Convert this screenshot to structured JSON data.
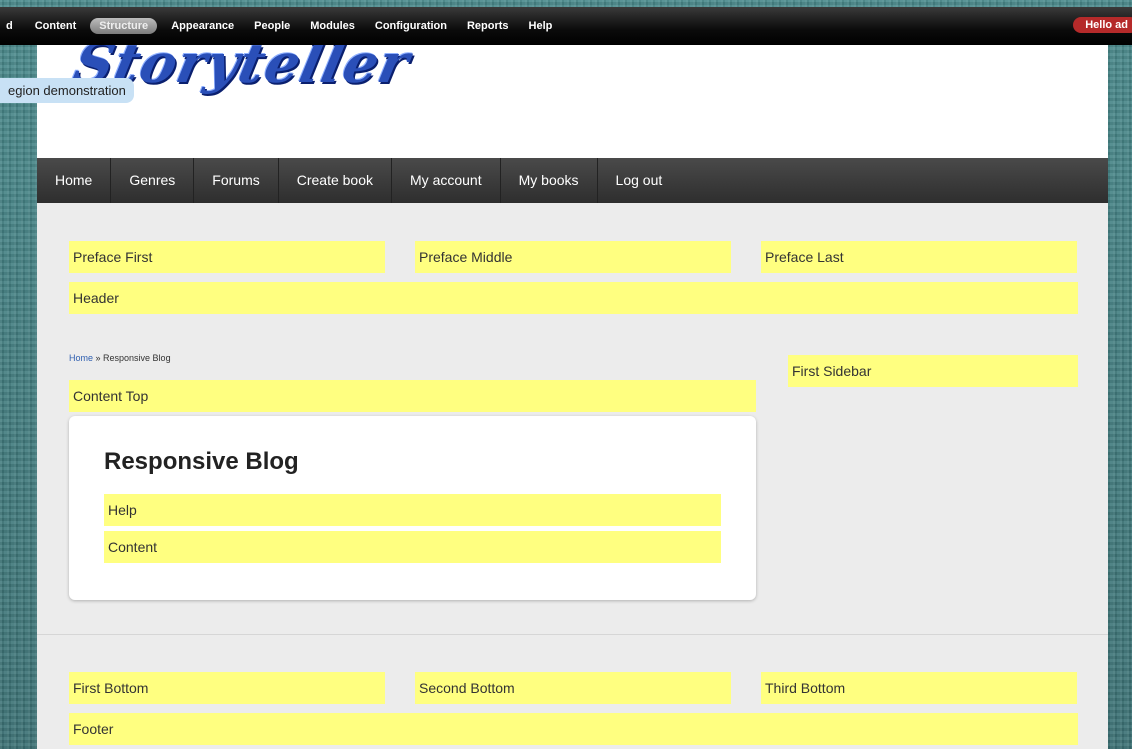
{
  "toolbar": {
    "items": [
      "d",
      "Content",
      "Structure",
      "Appearance",
      "People",
      "Modules",
      "Configuration",
      "Reports",
      "Help"
    ],
    "active": "Structure",
    "hello": "Hello ad"
  },
  "site": {
    "logo_text": "Storyteller",
    "region_demo": "egion demonstration"
  },
  "nav": {
    "items": [
      "Home",
      "Genres",
      "Forums",
      "Create book",
      "My account",
      "My books",
      "Log out"
    ]
  },
  "regions": {
    "preface_first": "Preface First",
    "preface_middle": "Preface Middle",
    "preface_last": "Preface Last",
    "header": "Header",
    "content_top": "Content Top",
    "first_sidebar": "First Sidebar",
    "help": "Help",
    "content": "Content",
    "first_bottom": "First Bottom",
    "second_bottom": "Second Bottom",
    "third_bottom": "Third Bottom",
    "footer": "Footer"
  },
  "breadcrumb": {
    "home": "Home",
    "separator": " » ",
    "current": "Responsive Blog"
  },
  "page_title": "Responsive Blog",
  "colors": {
    "region_bg": "#ffff80",
    "toolbar_bg": "#000000",
    "nav_bg": "#3a3a3a",
    "background": "#3f7a7e"
  }
}
